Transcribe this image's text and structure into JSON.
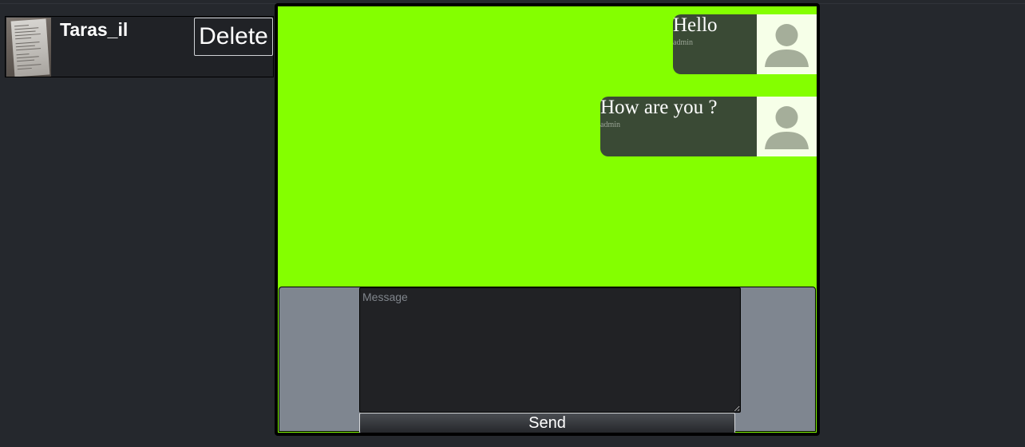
{
  "contact": {
    "name": "Taras_il",
    "avatar_icon": "document-photo-thumbnail",
    "delete_label": "Delete"
  },
  "chat": {
    "background_color": "#84ff00",
    "messages": [
      {
        "text": "Hello",
        "author": "admin",
        "avatar_icon": "user-silhouette-icon"
      },
      {
        "text": "How are you ?",
        "author": "admin",
        "avatar_icon": "user-silhouette-icon"
      }
    ]
  },
  "compose": {
    "placeholder": "Message",
    "send_label": "Send"
  }
}
